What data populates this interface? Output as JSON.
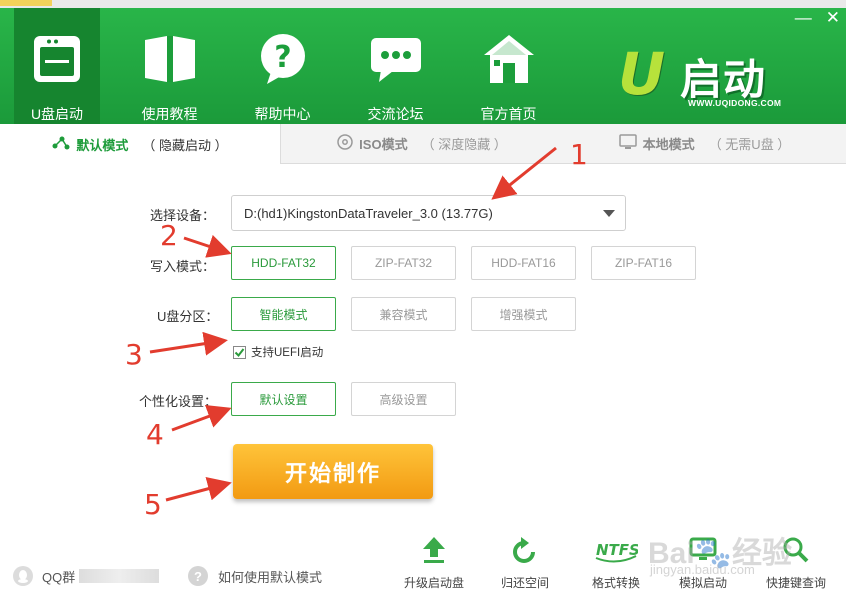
{
  "window": {
    "minimize": "—",
    "close": "✕"
  },
  "nav": [
    {
      "label": "U盘启动",
      "icon": "usb-window-icon",
      "active": true
    },
    {
      "label": "使用教程",
      "icon": "book-icon"
    },
    {
      "label": "帮助中心",
      "icon": "help-bubble-icon"
    },
    {
      "label": "交流论坛",
      "icon": "chat-bubble-icon"
    },
    {
      "label": "官方首页",
      "icon": "home-icon"
    }
  ],
  "logo": {
    "u": "U",
    "cn": "启动",
    "url": "WWW.UQIDONG.COM"
  },
  "tabs": [
    {
      "name": "默认模式",
      "sub": "（ 隐藏启动 ）"
    },
    {
      "name": "ISO模式",
      "sub": "（ 深度隐藏 ）"
    },
    {
      "name": "本地模式",
      "sub": "（ 无需U盘 ）"
    }
  ],
  "form": {
    "device_label": "选择设备：",
    "device_value": "D:(hd1)KingstonDataTraveler_3.0 (13.77G)",
    "write_label": "写入模式：",
    "write_options": [
      "HDD-FAT32",
      "ZIP-FAT32",
      "HDD-FAT16",
      "ZIP-FAT16"
    ],
    "partition_label": "U盘分区：",
    "partition_options": [
      "智能模式",
      "兼容模式",
      "增强模式"
    ],
    "uefi_label": "支持UEFI启动",
    "personal_label": "个性化设置：",
    "personal_options": [
      "默认设置",
      "高级设置"
    ],
    "start_label": "开始制作"
  },
  "annotations": [
    "1",
    "2",
    "3",
    "4",
    "5"
  ],
  "footer": {
    "qq_label": "QQ群",
    "help_label": "如何使用默认模式",
    "tools": [
      "升级启动盘",
      "归还空间",
      "格式转换",
      "模拟启动",
      "快捷键查询"
    ]
  },
  "watermark": {
    "main": "Bai🐾经验",
    "sub": "jingyan.baidu.com"
  },
  "colors": {
    "header_green": "#1ea33d",
    "active_green": "#16852f",
    "selected_border": "#3aaa4a",
    "start_orange": "#f6a91e",
    "annotation_red": "#e23c2e"
  }
}
